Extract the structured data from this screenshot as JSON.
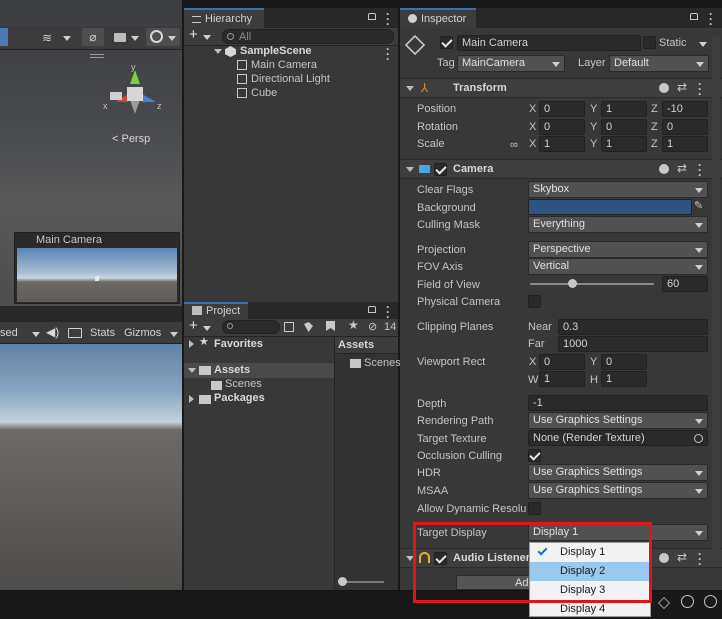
{
  "scene": {
    "persp_label": "< Persp",
    "axis_y": "y",
    "axis_x": "x",
    "axis_z": "z",
    "camera_preview_title": "Main Camera"
  },
  "game_view": {
    "toolbar_partial": "sed",
    "stats_label": "Stats",
    "gizmos_label": "Gizmos"
  },
  "hierarchy": {
    "tab_label": "Hierarchy",
    "search_placeholder": "All",
    "scene_name": "SampleScene",
    "items": [
      {
        "label": "Main Camera"
      },
      {
        "label": "Directional Light"
      },
      {
        "label": "Cube"
      }
    ]
  },
  "project": {
    "tab_label": "Project",
    "hidden_count": "14",
    "favorites_label": "Favorites",
    "assets_label": "Assets",
    "scenes_label": "Scenes",
    "packages_label": "Packages",
    "right_header": "Assets",
    "right_item": "Scenes"
  },
  "inspector": {
    "tab_label": "Inspector",
    "object_name": "Main Camera",
    "static_label": "Static",
    "tag_label": "Tag",
    "tag_value": "MainCamera",
    "layer_label": "Layer",
    "layer_value": "Default",
    "transform": {
      "title": "Transform",
      "position_label": "Position",
      "rotation_label": "Rotation",
      "scale_label": "Scale",
      "position": {
        "x": "0",
        "y": "1",
        "z": "-10"
      },
      "rotation": {
        "x": "0",
        "y": "0",
        "z": "0"
      },
      "scale": {
        "x": "1",
        "y": "1",
        "z": "1"
      }
    },
    "camera": {
      "title": "Camera",
      "clear_flags_label": "Clear Flags",
      "clear_flags_value": "Skybox",
      "background_label": "Background",
      "background_color": "#31537f",
      "culling_mask_label": "Culling Mask",
      "culling_mask_value": "Everything",
      "projection_label": "Projection",
      "projection_value": "Perspective",
      "fov_axis_label": "FOV Axis",
      "fov_axis_value": "Vertical",
      "fov_label": "Field of View",
      "fov_value": "60",
      "physical_camera_label": "Physical Camera",
      "clipping_label": "Clipping Planes",
      "near_label": "Near",
      "near_value": "0.3",
      "far_label": "Far",
      "far_value": "1000",
      "viewport_label": "Viewport Rect",
      "viewport": {
        "x": "0",
        "y": "0",
        "w": "1",
        "h": "1"
      },
      "depth_label": "Depth",
      "depth_value": "-1",
      "rendering_path_label": "Rendering Path",
      "rendering_path_value": "Use Graphics Settings",
      "target_texture_label": "Target Texture",
      "target_texture_value": "None (Render Texture)",
      "occlusion_label": "Occlusion Culling",
      "hdr_label": "HDR",
      "hdr_value": "Use Graphics Settings",
      "msaa_label": "MSAA",
      "msaa_value": "Use Graphics Settings",
      "dynamic_res_label": "Allow Dynamic Resolu",
      "target_display_label": "Target Display",
      "target_display_value": "Display 1"
    },
    "audio_listener": {
      "title": "Audio Listener"
    },
    "add_component_partial": "Ad"
  },
  "display_menu": {
    "options": [
      "Display 1",
      "Display 2",
      "Display 3",
      "Display 4"
    ],
    "checked_index": 0,
    "hover_index": 1
  },
  "colors": {
    "accent_blue": "#3a72b0",
    "highlight_red": "#e0141e",
    "menu_hover": "#99c9ef"
  }
}
